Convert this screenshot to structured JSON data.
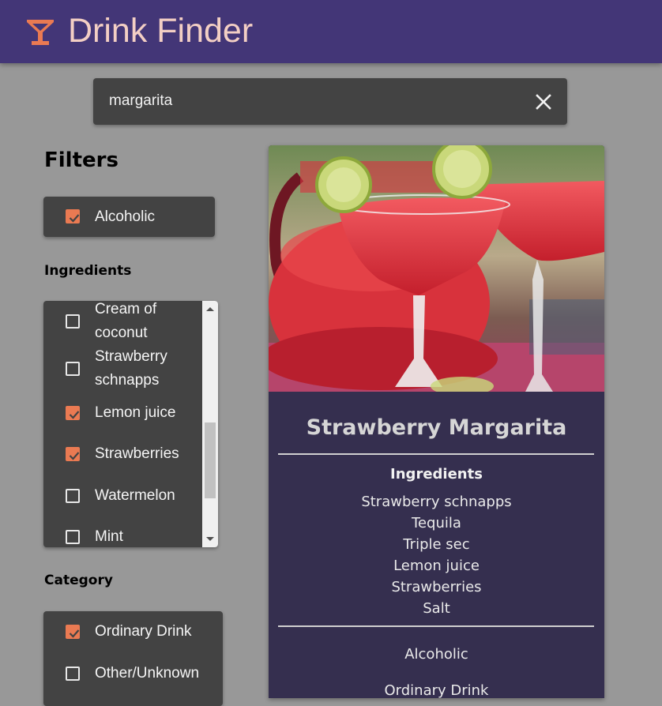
{
  "header": {
    "title": "Drink Finder",
    "logo_icon": "cocktail-glass-icon",
    "background_color": "#433677",
    "title_color": "#f3cfc4",
    "logo_color": "#ea7a52"
  },
  "search": {
    "value": "margarita",
    "clear_icon": "close-icon"
  },
  "filters": {
    "heading": "Filters",
    "alcoholic": {
      "label": "Alcoholic",
      "checked": true
    },
    "ingredients": {
      "label": "Ingredients",
      "items": [
        {
          "label": "Cream of coconut",
          "checked": false
        },
        {
          "label": "Strawberry schnapps",
          "checked": false
        },
        {
          "label": "Lemon juice",
          "checked": true
        },
        {
          "label": "Strawberries",
          "checked": true
        },
        {
          "label": "Watermelon",
          "checked": false
        },
        {
          "label": "Mint",
          "checked": false
        }
      ]
    },
    "category": {
      "label": "Category",
      "items": [
        {
          "label": "Ordinary Drink",
          "checked": true
        },
        {
          "label": "Other/Unknown",
          "checked": false
        }
      ]
    },
    "accent_color": "#ea7a52"
  },
  "result": {
    "name": "Strawberry Margarita",
    "ingredients_heading": "Ingredients",
    "ingredients": [
      "Strawberry schnapps",
      "Tequila",
      "Triple sec",
      "Lemon juice",
      "Strawberries",
      "Salt"
    ],
    "alcoholic": "Alcoholic",
    "category": "Ordinary Drink",
    "card_color": "#352f4f"
  }
}
